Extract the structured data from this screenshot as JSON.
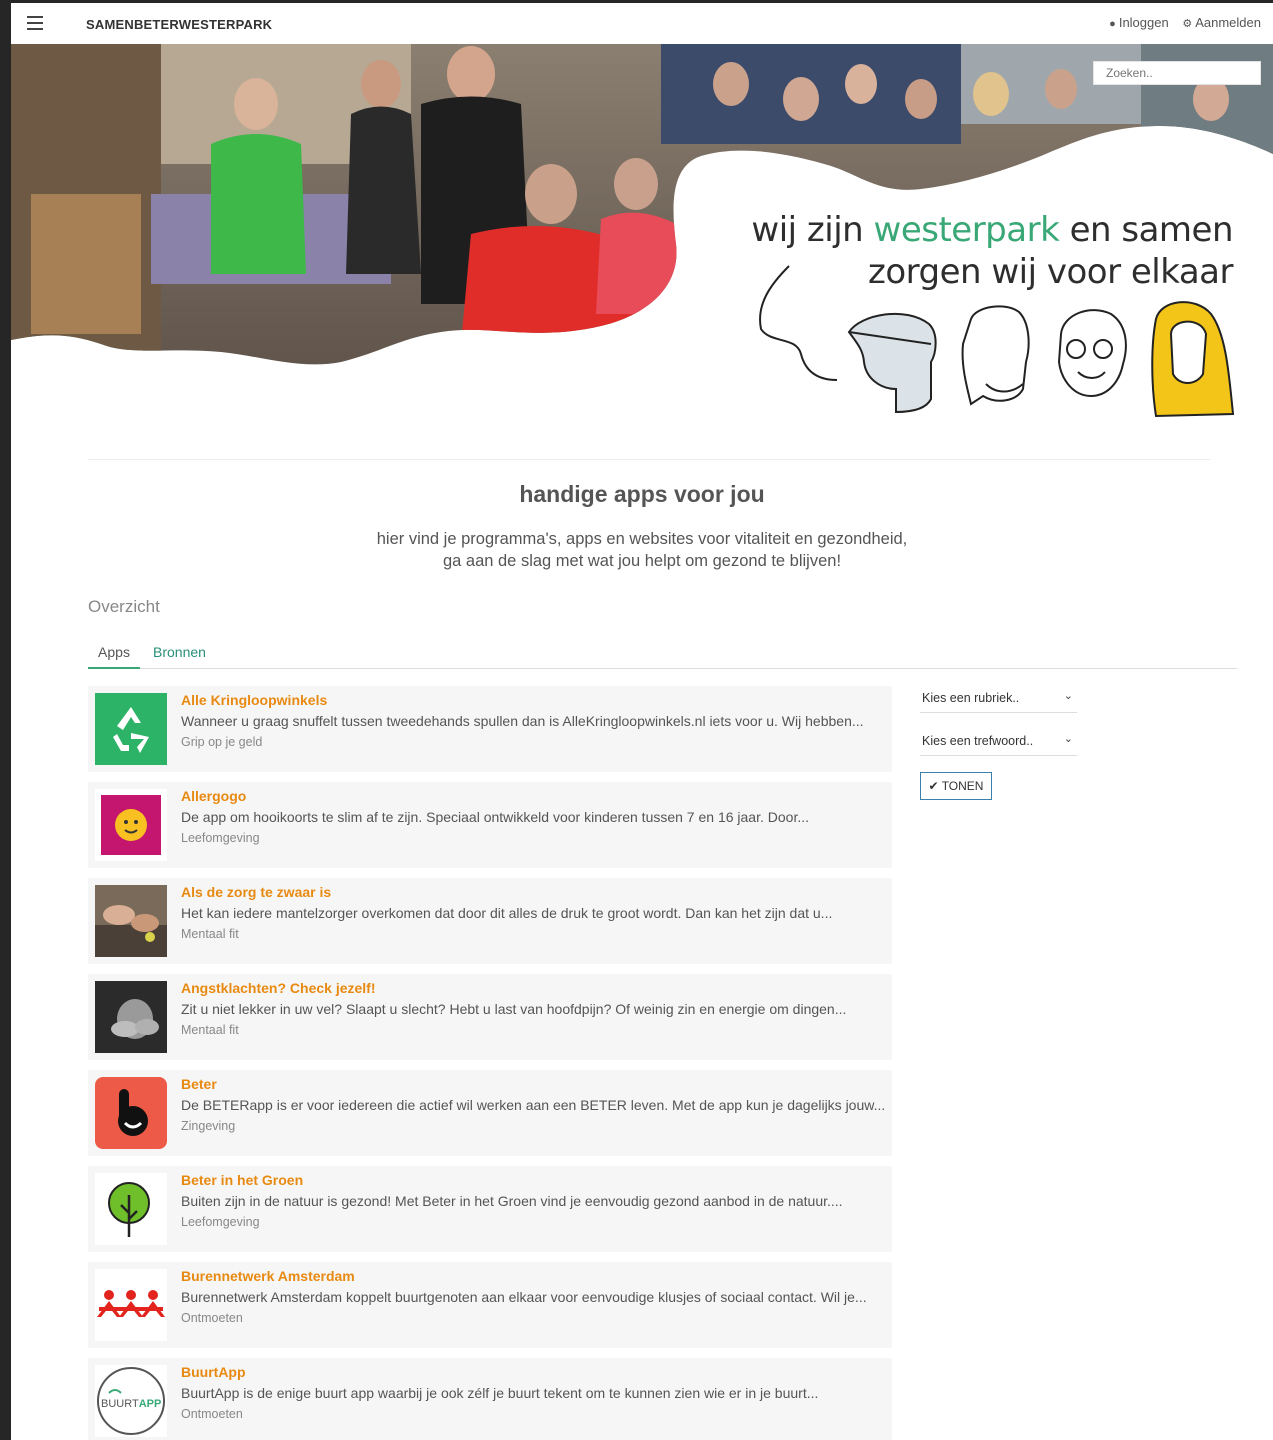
{
  "topbar": {
    "brand": "SAMENBETERWESTERPARK",
    "login": "Inloggen",
    "register": "Aanmelden"
  },
  "hero": {
    "search_placeholder": "Zoeken..",
    "tagline_part1": "wij zijn ",
    "tagline_accent": "westerpark",
    "tagline_part2": " en samen",
    "tagline_line2": "zorgen wij voor elkaar"
  },
  "section": {
    "title": "handige apps voor jou",
    "sub_line1": "hier vind je programma's, apps en websites voor vitaliteit en gezondheid,",
    "sub_line2": "ga aan de slag met wat jou helpt om gezond te blijven!"
  },
  "overview_label": "Overzicht",
  "tabs": [
    {
      "label": "Apps"
    },
    {
      "label": "Bronnen"
    }
  ],
  "items": [
    {
      "title": "Alle Kringloopwinkels",
      "desc": "Wanneer u graag snuffelt tussen tweedehands spullen dan is AlleKringloopwinkels.nl iets voor u. Wij hebben...",
      "category": "Grip op je geld"
    },
    {
      "title": "Allergogo",
      "desc": "De app om hooikoorts te slim af te zijn. Speciaal ontwikkeld voor kinderen tussen 7 en 16 jaar. Door...",
      "category": "Leefomgeving"
    },
    {
      "title": "Als de zorg te zwaar is",
      "desc": "Het kan iedere mantelzorger overkomen dat door dit alles de druk te groot wordt. Dan kan het zijn dat u...",
      "category": "Mentaal fit"
    },
    {
      "title": "Angstklachten? Check jezelf!",
      "desc": "Zit u niet lekker in uw vel? Slaapt u slecht? Hebt u last van hoofdpijn? Of weinig zin en energie om dingen...",
      "category": "Mentaal fit"
    },
    {
      "title": "Beter",
      "desc": "De BETERapp is er voor iedereen die actief wil werken aan een BETER leven. Met de app kun je dagelijks jouw...",
      "category": "Zingeving"
    },
    {
      "title": "Beter in het Groen",
      "desc": "Buiten zijn in de natuur is gezond! Met Beter in het Groen vind je eenvoudig gezond aanbod in de natuur....",
      "category": "Leefomgeving"
    },
    {
      "title": "Burennetwerk Amsterdam",
      "desc": "Burennetwerk Amsterdam koppelt buurtgenoten aan elkaar voor eenvoudige klusjes of sociaal contact. Wil je...",
      "category": "Ontmoeten"
    },
    {
      "title": "BuurtApp",
      "desc": "BuurtApp is de enige buurt app waarbij je ook zélf je buurt tekent om te kunnen zien wie er in je buurt...",
      "category": "Ontmoeten"
    }
  ],
  "filters": {
    "rubriek": "Kies een rubriek..",
    "trefwoord": "Kies een trefwoord..",
    "button": "TONEN"
  },
  "logo_text": {
    "buurtapp_a": "BUURT",
    "buurtapp_b": "APP"
  },
  "colors": {
    "accent_green": "#3aa876",
    "title_orange": "#e88a12",
    "tab_link": "#2a8f7a"
  }
}
